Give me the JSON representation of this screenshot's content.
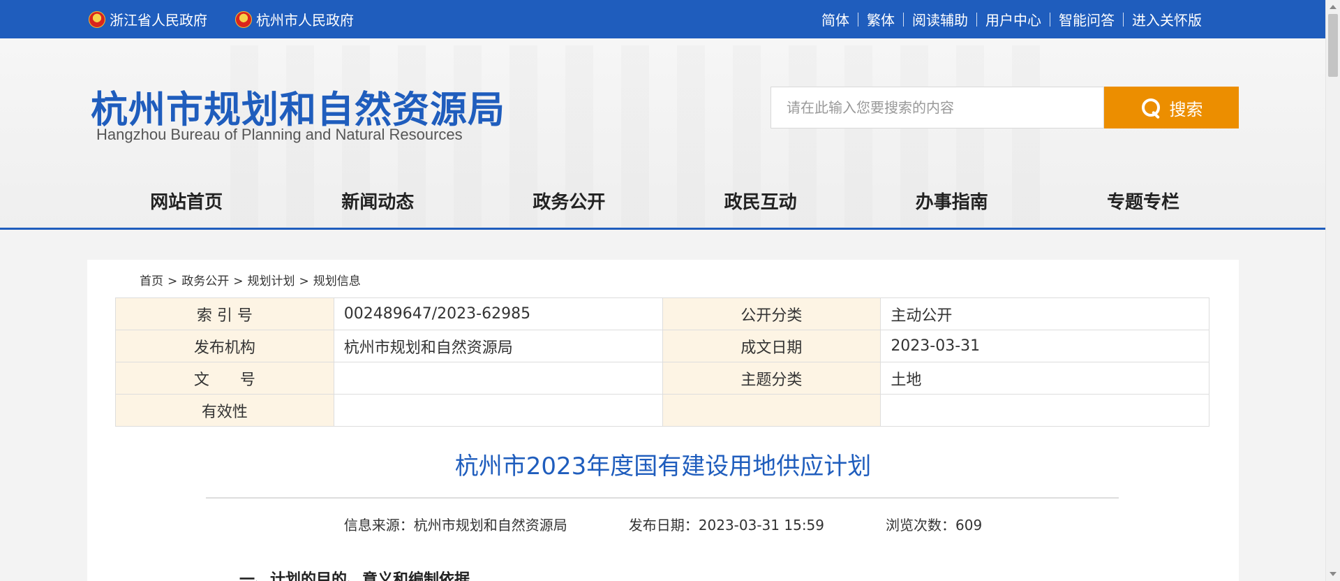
{
  "topbar": {
    "gov_links": [
      "浙江省人民政府",
      "杭州市人民政府"
    ],
    "right_links": [
      "简体",
      "繁体",
      "阅读辅助",
      "用户中心",
      "智能问答",
      "进入关怀版"
    ],
    "bg_color": "#1f5dbd"
  },
  "header": {
    "logo_cn": "杭州市规划和自然资源局",
    "logo_en": "Hangzhou Bureau of Planning and Natural Resources",
    "search_placeholder": "请在此输入您要搜索的内容",
    "search_button": "搜索",
    "search_icon": "magnifier-icon",
    "accent_color": "#ec8e00"
  },
  "nav": {
    "items": [
      "网站首页",
      "新闻动态",
      "政务公开",
      "政民互动",
      "办事指南",
      "专题专栏"
    ]
  },
  "breadcrumb": [
    "首页",
    "政务公开",
    "规划计划",
    "规划信息"
  ],
  "breadcrumb_sep": ">",
  "meta_table": {
    "rows": [
      [
        "索 引 号",
        "002489647/2023-62985",
        "公开分类",
        "主动公开"
      ],
      [
        "发布机构",
        "杭州市规划和自然资源局",
        "成文日期",
        "2023-03-31"
      ],
      [
        "文　　号",
        "",
        "主题分类",
        "土地"
      ],
      [
        "有效性",
        "",
        "",
        ""
      ]
    ]
  },
  "article": {
    "title": "杭州市2023年度国有建设用地供应计划",
    "source": "信息来源：杭州市规划和自然资源局",
    "publish_date": "发布日期：2023-03-31 15:59",
    "views": "浏览次数：609",
    "section_heading": "一、计划的目的、意义和编制依据"
  }
}
